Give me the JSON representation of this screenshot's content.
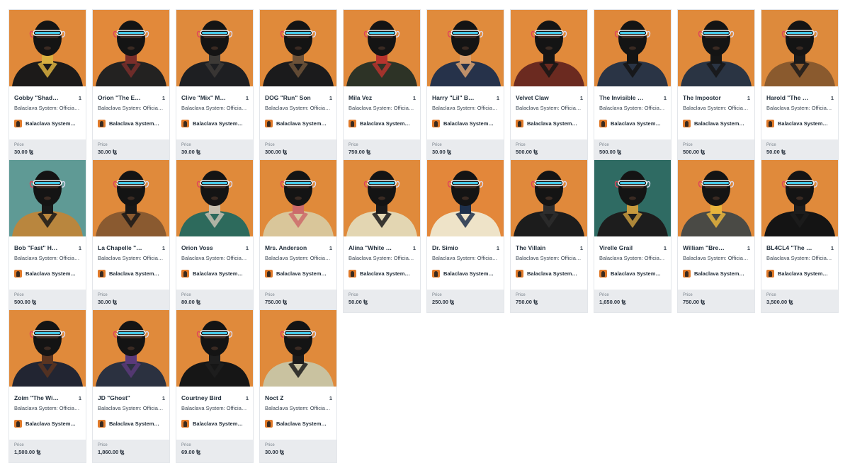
{
  "cards": [
    {
      "title": "Gobby \"Shad…",
      "qty": "1",
      "collection": "Balaclava System: Officia…",
      "creator": "Balaclava System…",
      "price_label": "Price",
      "price": "30.00 ꜩ",
      "bg": "#e0893a",
      "figure": "#1c1a19",
      "accent": "#d9b040"
    },
    {
      "title": "Orion \"The E…",
      "qty": "1",
      "collection": "Balaclava System: Officia…",
      "creator": "Balaclava System…",
      "price_label": "Price",
      "price": "30.00 ꜩ",
      "bg": "#e2893a",
      "figure": "#232221",
      "accent": "#7a2e2a"
    },
    {
      "title": "Clive \"Mix\" M…",
      "qty": "1",
      "collection": "Balaclava System: Officia…",
      "creator": "Balaclava System…",
      "price_label": "Price",
      "price": "30.00 ꜩ",
      "bg": "#df8a3c",
      "figure": "#1e1f22",
      "accent": "#3d3a36"
    },
    {
      "title": "DOG \"Run\" Son",
      "qty": "1",
      "collection": "Balaclava System: Officia…",
      "creator": "Balaclava System…",
      "price_label": "Price",
      "price": "300.00 ꜩ",
      "bg": "#e08a3a",
      "figure": "#1b1b1c",
      "accent": "#6d5238"
    },
    {
      "title": "Mila Vez",
      "qty": "1",
      "collection": "Balaclava System: Officia…",
      "creator": "Balaclava System…",
      "price_label": "Price",
      "price": "750.00 ꜩ",
      "bg": "#e0893b",
      "figure": "#2d3326",
      "accent": "#b7342e"
    },
    {
      "title": "Harry \"Lil\" B…",
      "qty": "1",
      "collection": "Balaclava System: Officia…",
      "creator": "Balaclava System…",
      "price_label": "Price",
      "price": "30.00 ꜩ",
      "bg": "#e08b3c",
      "figure": "#26324a",
      "accent": "#d8a06e"
    },
    {
      "title": "Velvet Claw",
      "qty": "1",
      "collection": "Balaclava System: Officia…",
      "creator": "Balaclava System…",
      "price_label": "Price",
      "price": "500.00 ꜩ",
      "bg": "#e18a3b",
      "figure": "#6b2a20",
      "accent": "#151515"
    },
    {
      "title": "The Invisible …",
      "qty": "1",
      "collection": "Balaclava System: Officia…",
      "creator": "Balaclava System…",
      "price_label": "Price",
      "price": "500.00 ꜩ",
      "bg": "#df883a",
      "figure": "#2a3445",
      "accent": "#141414"
    },
    {
      "title": "The Impostor",
      "qty": "1",
      "collection": "Balaclava System: Officia…",
      "creator": "Balaclava System…",
      "price_label": "Price",
      "price": "500.00 ꜩ",
      "bg": "#e08a3b",
      "figure": "#2a3443",
      "accent": "#161616"
    },
    {
      "title": "Harold \"The …",
      "qty": "1",
      "collection": "Balaclava System: Officia…",
      "creator": "Balaclava System…",
      "price_label": "Price",
      "price": "50.00 ꜩ",
      "bg": "#dd8a3c",
      "figure": "#8a5a2e",
      "accent": "#1a1a1a"
    },
    {
      "title": "Bob \"Fast\" H…",
      "qty": "1",
      "collection": "Balaclava System: Officia…",
      "creator": "Balaclava System…",
      "price_label": "Price",
      "price": "500.00 ꜩ",
      "bg": "#5f9a95",
      "figure": "#b9863e",
      "accent": "#181818"
    },
    {
      "title": "La Chapelle \"…",
      "qty": "1",
      "collection": "Balaclava System: Officia…",
      "creator": "Balaclava System…",
      "price_label": "Price",
      "price": "30.00 ꜩ",
      "bg": "#e08a3b",
      "figure": "#8a5a30",
      "accent": "#171717"
    },
    {
      "title": "Orion Voss",
      "qty": "1",
      "collection": "Balaclava System: Officia…",
      "creator": "Balaclava System…",
      "price_label": "Price",
      "price": "80.00 ꜩ",
      "bg": "#e08a3a",
      "figure": "#2d6a5c",
      "accent": "#c7c0b0"
    },
    {
      "title": "Mrs. Anderson",
      "qty": "1",
      "collection": "Balaclava System: Officia…",
      "creator": "Balaclava System…",
      "price_label": "Price",
      "price": "750.00 ꜩ",
      "bg": "#e08a3a",
      "figure": "#d9c69a",
      "accent": "#cc6a6a"
    },
    {
      "title": "Alina \"White …",
      "qty": "1",
      "collection": "Balaclava System: Officia…",
      "creator": "Balaclava System…",
      "price_label": "Price",
      "price": "50.00 ꜩ",
      "bg": "#e08a3b",
      "figure": "#e3d6b2",
      "accent": "#1a1a1a"
    },
    {
      "title": "Dr. Simio",
      "qty": "1",
      "collection": "Balaclava System: Officia…",
      "creator": "Balaclava System…",
      "price_label": "Price",
      "price": "250.00 ꜩ",
      "bg": "#e3873a",
      "figure": "#eee3c8",
      "accent": "#1d2f4a"
    },
    {
      "title": "The Villain",
      "qty": "1",
      "collection": "Balaclava System: Officia…",
      "creator": "Balaclava System…",
      "price_label": "Price",
      "price": "750.00 ꜩ",
      "bg": "#e0893b",
      "figure": "#1c1c1c",
      "accent": "#2d2d2d"
    },
    {
      "title": "Virelle Grail",
      "qty": "1",
      "collection": "Balaclava System: Officia…",
      "creator": "Balaclava System…",
      "price_label": "Price",
      "price": "1,650.00 ꜩ",
      "bg": "#2f6b63",
      "figure": "#1d1d1d",
      "accent": "#c79a3e"
    },
    {
      "title": "William \"Bre…",
      "qty": "1",
      "collection": "Balaclava System: Officia…",
      "creator": "Balaclava System…",
      "price_label": "Price",
      "price": "750.00 ꜩ",
      "bg": "#e08a3b",
      "figure": "#4a4a45",
      "accent": "#e8b43c"
    },
    {
      "title": "BL4CL4 \"The …",
      "qty": "1",
      "collection": "Balaclava System: Officia…",
      "creator": "Balaclava System…",
      "price_label": "Price",
      "price": "3,500.00 ꜩ",
      "bg": "#e08a3b",
      "figure": "#141414",
      "accent": "#1c1c1c"
    },
    {
      "title": "Zoim \"The Wi…",
      "qty": "1",
      "collection": "Balaclava System: Officia…",
      "creator": "Balaclava System…",
      "price_label": "Price",
      "price": "1,500.00 ꜩ",
      "bg": "#e08a3b",
      "figure": "#222532",
      "accent": "#5a3420"
    },
    {
      "title": "JD \"Ghost\"",
      "qty": "1",
      "collection": "Balaclava System: Officia…",
      "creator": "Balaclava System…",
      "price_label": "Price",
      "price": "1,860.00 ꜩ",
      "bg": "#e08a3b",
      "figure": "#2b3140",
      "accent": "#5a3a7a"
    },
    {
      "title": "Courtney Bird",
      "qty": "1",
      "collection": "Balaclava System: Officia…",
      "creator": "Balaclava System…",
      "price_label": "Price",
      "price": "69.00 ꜩ",
      "bg": "#e08a3b",
      "figure": "#161616",
      "accent": "#1e1e1e"
    },
    {
      "title": "Noct Z",
      "qty": "1",
      "collection": "Balaclava System: Officia…",
      "creator": "Balaclava System…",
      "price_label": "Price",
      "price": "30.00 ꜩ",
      "bg": "#e08a3b",
      "figure": "#c9c2a0",
      "accent": "#1b1b1b"
    }
  ]
}
